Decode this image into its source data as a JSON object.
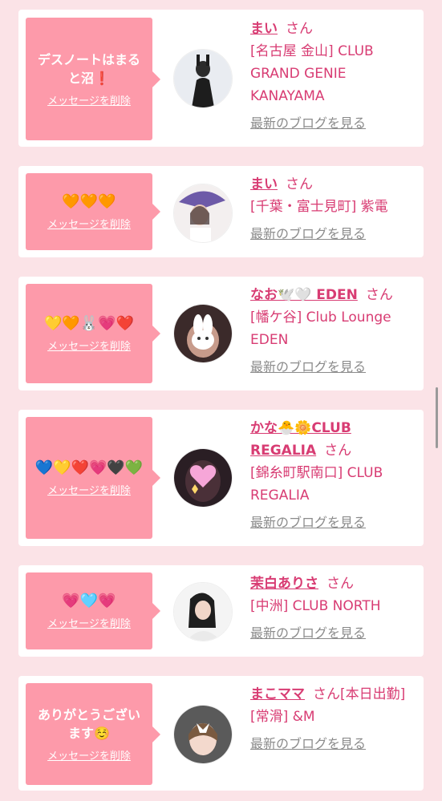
{
  "delete_label": "メッセージを削除",
  "blog_label": "最新のブログを見る",
  "san_label": "さん",
  "cards": [
    {
      "message": "デスノートはまると沼❗",
      "name": "まい",
      "shop": "[名古屋 金山] CLUB GRAND GENIE KANAYAMA",
      "extra": ""
    },
    {
      "message": "🧡🧡🧡",
      "name": "まい",
      "shop": "[千葉・富士見町] 紫電",
      "extra": ""
    },
    {
      "message": "💛🧡🐰💗❤️",
      "name": "なお🕊️🤍 EDEN",
      "shop": "[幡ケ谷] Club Lounge EDEN",
      "extra": ""
    },
    {
      "message": "💙💛❤️💗🖤💚",
      "name": "かな🐣🌼CLUB REGALIA",
      "shop": "[錦糸町駅南口] CLUB REGALIA",
      "extra": ""
    },
    {
      "message": "💗🩵💗",
      "name": "茉白ありさ",
      "shop": "[中洲] CLUB NORTH",
      "extra": ""
    },
    {
      "message": "ありがとうございます☺️",
      "name": "まこママ",
      "shop": "[常滑] &M",
      "extra": "[本日出勤]"
    }
  ]
}
